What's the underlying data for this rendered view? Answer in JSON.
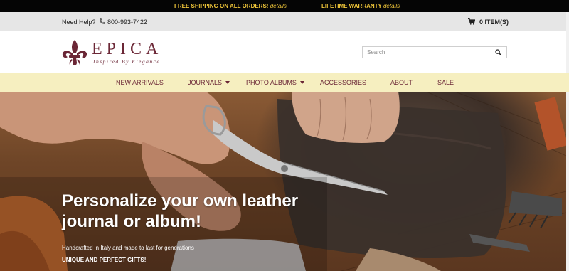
{
  "promo": {
    "shipping_text": "FREE SHIPPING ON ALL ORDERS!",
    "shipping_link": "details",
    "warranty_text": "LIFETIME WARRANTY",
    "warranty_link": "details"
  },
  "help_bar": {
    "need_help": "Need Help?",
    "phone": "800-993-7422",
    "cart_label": "0 ITEM(S)"
  },
  "logo": {
    "name": "EPICA",
    "tagline": "Inspired By Elegance"
  },
  "search": {
    "placeholder": "Search"
  },
  "nav": {
    "items": [
      {
        "label": "NEW ARRIVALS",
        "has_dropdown": false
      },
      {
        "label": "JOURNALS",
        "has_dropdown": true
      },
      {
        "label": "PHOTO ALBUMS",
        "has_dropdown": true
      },
      {
        "label": "ACCESSORIES",
        "has_dropdown": false
      },
      {
        "label": "ABOUT",
        "has_dropdown": false
      },
      {
        "label": "SALE",
        "has_dropdown": false
      }
    ]
  },
  "hero": {
    "headline": "Personalize your own leather journal or album!",
    "subtext": "Handcrafted in Italy and made to last for generations",
    "tagline": "UNIQUE AND PERFECT GIFTS!"
  },
  "colors": {
    "brand": "#6b2736",
    "promo_accent": "#f0c63a",
    "nav_background": "#f6efc0"
  }
}
